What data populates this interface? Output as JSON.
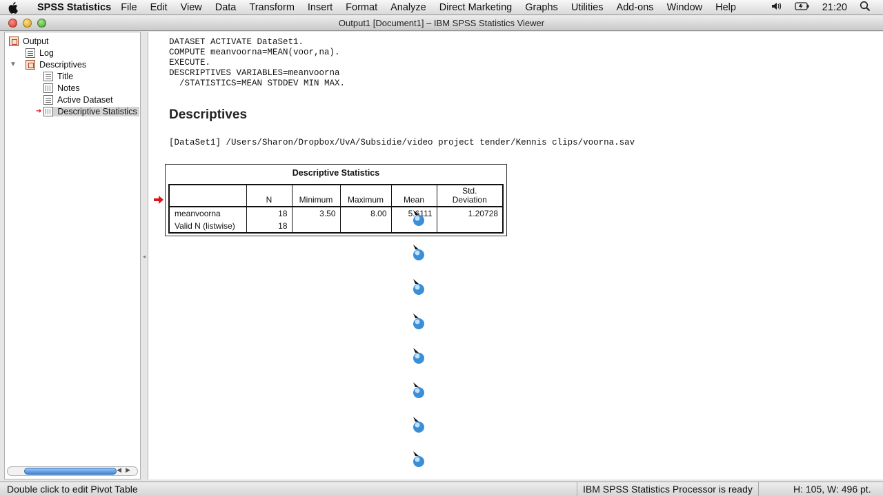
{
  "menubar": {
    "app_name": "SPSS Statistics",
    "items": [
      "File",
      "Edit",
      "View",
      "Data",
      "Transform",
      "Insert",
      "Format",
      "Analyze",
      "Direct Marketing",
      "Graphs",
      "Utilities",
      "Add-ons",
      "Window",
      "Help"
    ],
    "clock": "21:20"
  },
  "window": {
    "title": "Output1 [Document1] – IBM SPSS Statistics Viewer"
  },
  "nav": {
    "output": "Output",
    "log": "Log",
    "descriptives": "Descriptives",
    "title": "Title",
    "notes": "Notes",
    "active_dataset": "Active Dataset",
    "descriptive_statistics": "Descriptive Statistics"
  },
  "content": {
    "syntax": [
      "DATASET ACTIVATE DataSet1.",
      "COMPUTE meanvoorna=MEAN(voor,na).",
      "EXECUTE.",
      "DESCRIPTIVES VARIABLES=meanvoorna",
      "  /STATISTICS=MEAN STDDEV MIN MAX."
    ],
    "heading": "Descriptives",
    "dataset_line": "[DataSet1] /Users/Sharon/Dropbox/UvA/Subsidie/video project tender/Kennis clips/voorna.sav"
  },
  "table": {
    "title": "Descriptive Statistics",
    "headers": {
      "n": "N",
      "minimum": "Minimum",
      "maximum": "Maximum",
      "mean": "Mean",
      "std_line1": "Std.",
      "std_line2": "Deviation"
    },
    "rows": [
      {
        "label": "meanvoorna",
        "n": "18",
        "minimum": "3.50",
        "maximum": "8.00",
        "mean": "5.6111",
        "std": "1.20728"
      },
      {
        "label": "Valid N (listwise)",
        "n": "18",
        "minimum": "",
        "maximum": "",
        "mean": "",
        "std": ""
      }
    ]
  },
  "status": {
    "left": "Double click to edit Pivot Table",
    "processor": "IBM SPSS Statistics Processor is ready",
    "dims": "H: 105, W: 496 pt."
  },
  "colors": {
    "accent_red": "#d9141a",
    "scroll_blue": "#3b86d9"
  }
}
